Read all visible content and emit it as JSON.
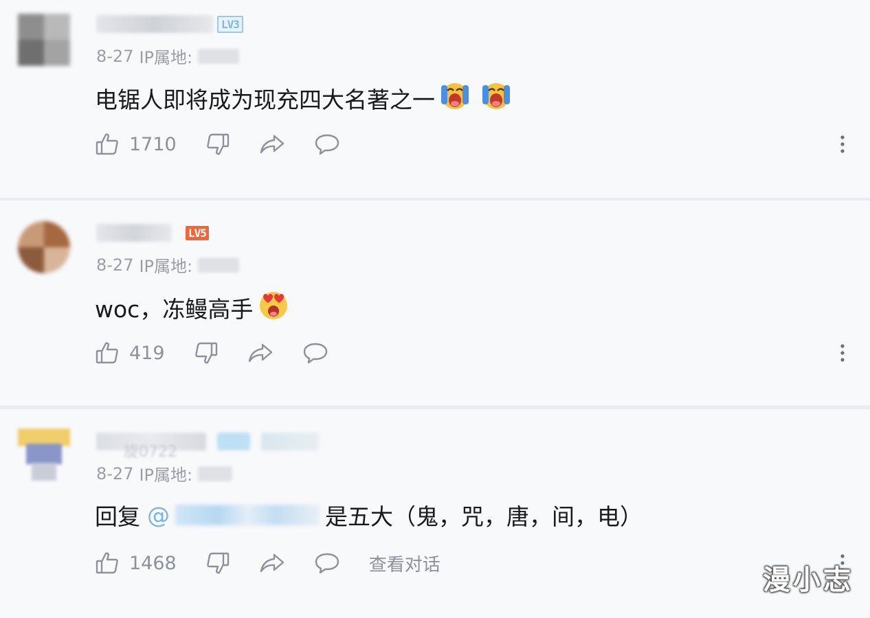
{
  "comments": [
    {
      "badge": "LV3",
      "date": "8-27",
      "ip_label": "IP属地:",
      "text": "电锯人即将成为现充四大名著之一",
      "emojis": [
        "crying-face-emoji",
        "crying-face-emoji"
      ],
      "likes": "1710"
    },
    {
      "badge": "LV5",
      "date": "8-27",
      "ip_label": "IP属地:",
      "text": "woc，冻鳗高手",
      "emojis": [
        "heart-eyes-emoji"
      ],
      "likes": "419"
    },
    {
      "partial_name": "旋0722",
      "date": "8-27",
      "ip_label": "IP属地:",
      "reply_prefix": "回复",
      "mention_at": "@",
      "text": "是五大（鬼，咒，唐，间，电）",
      "likes": "1468",
      "view_conversation": "查看对话"
    }
  ],
  "watermark": "漫小志",
  "colors": {
    "background": "#f8f9fb",
    "separator": "#ebedf0",
    "meta_text": "#9a9ea8",
    "icon": "#8d919a",
    "mention": "#7ab4e3",
    "badge_orange": "#f2673a",
    "badge_blue": "#9ac8ee"
  },
  "icons": [
    "thumbs-up-icon",
    "thumbs-down-icon",
    "share-icon",
    "comment-icon",
    "more-vertical-icon"
  ]
}
